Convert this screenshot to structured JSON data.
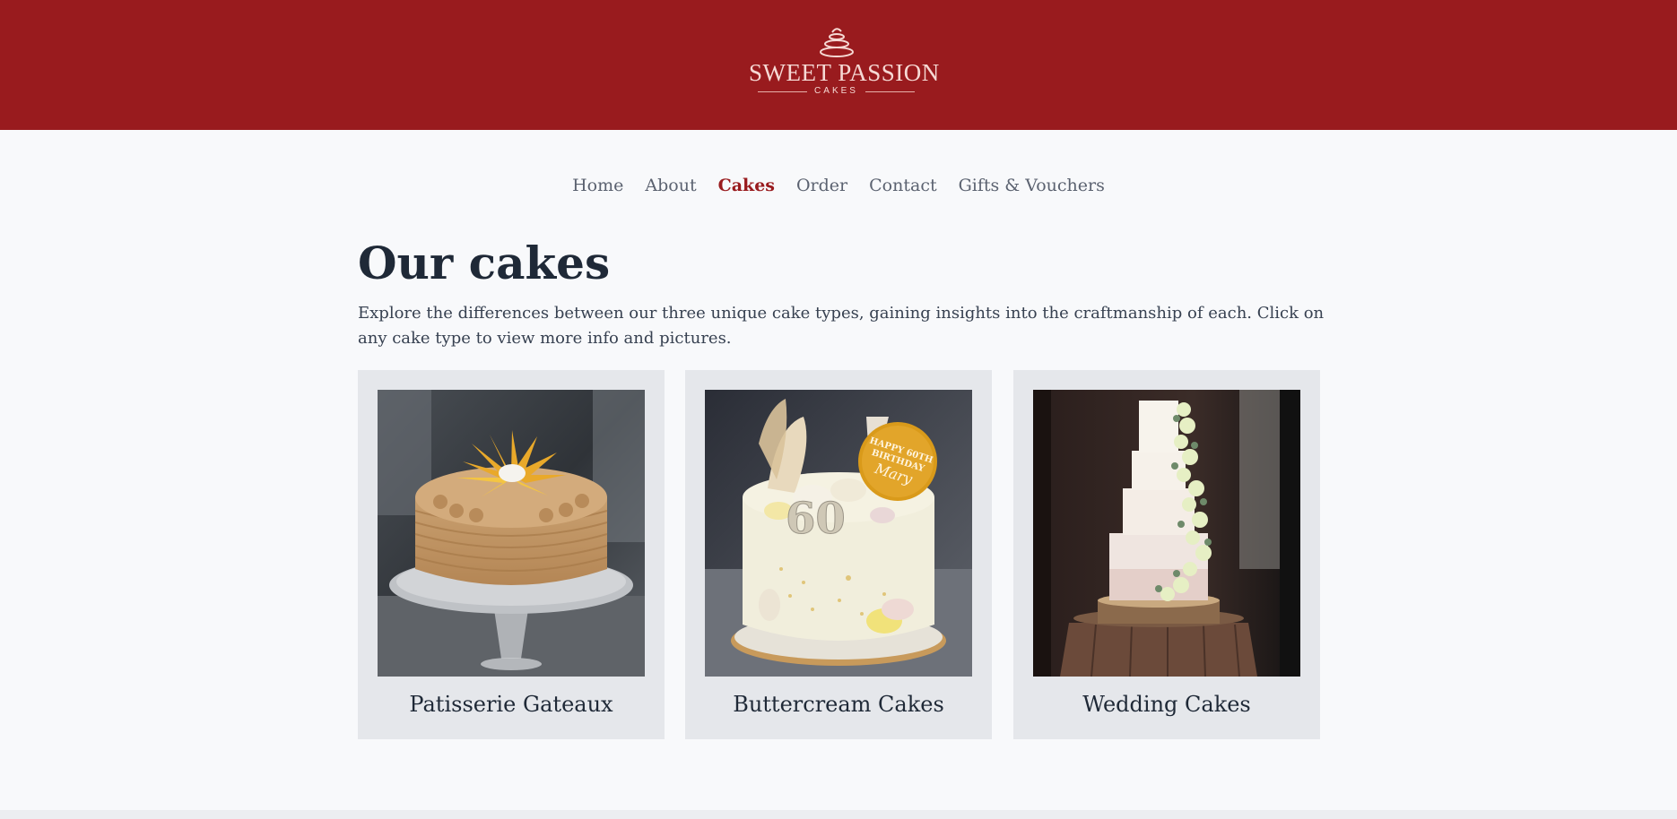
{
  "brand": {
    "name": "SWEET PASSION",
    "tagline": "CAKES",
    "header_color": "#991b1e",
    "logo_icon": "stacked-cake-icon"
  },
  "nav": {
    "items": [
      {
        "label": "Home",
        "active": false
      },
      {
        "label": "About",
        "active": false
      },
      {
        "label": "Cakes",
        "active": true
      },
      {
        "label": "Order",
        "active": false
      },
      {
        "label": "Contact",
        "active": false
      },
      {
        "label": "Gifts & Vouchers",
        "active": false
      }
    ]
  },
  "main": {
    "title": "Our cakes",
    "intro": "Explore the differences between our three unique cake types, gaining insights into the craftmanship of each. Click on any cake type to view more info and pictures."
  },
  "cards": [
    {
      "label": "Patisserie Gateaux",
      "image": "patisserie-gateaux-photo"
    },
    {
      "label": "Buttercream Cakes",
      "image": "buttercream-cake-photo",
      "topper_text": "HAPPY 60TH BIRTHDAY Mary",
      "candle_text": "60"
    },
    {
      "label": "Wedding Cakes",
      "image": "wedding-cake-photo"
    }
  ]
}
